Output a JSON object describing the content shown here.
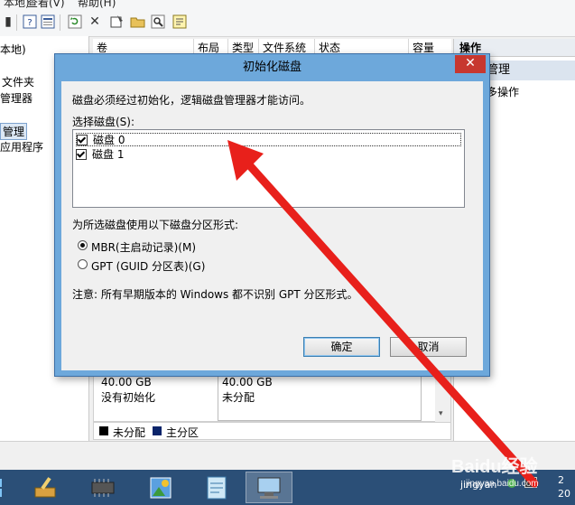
{
  "menubar": {
    "items": [
      "本地)",
      "查看(V)",
      "帮助(H)"
    ]
  },
  "toolbar": {
    "icons": [
      "back-icon",
      "up-icon",
      "help-icon",
      "properties-icon",
      "refresh-icon",
      "delete-icon",
      "settings-icon",
      "open-folder-icon",
      "search-icon",
      "export-icon"
    ]
  },
  "tree": {
    "items": [
      "本地)",
      "文件夹",
      "管理器",
      "管理",
      "应用程序"
    ]
  },
  "list_header": {
    "columns": [
      "卷",
      "布局",
      "类型",
      "文件系统",
      "状态",
      "容量"
    ]
  },
  "disk_area": {
    "disk0": {
      "size": "40.00 GB",
      "status": "没有初始化"
    },
    "disk1": {
      "size": "40.00 GB",
      "status": "未分配"
    }
  },
  "legend": {
    "unallocated": "未分配",
    "primary": "主分区"
  },
  "actions": {
    "header": "操作",
    "subheader": "管理",
    "more": "多操作"
  },
  "dialog": {
    "title": "初始化磁盘",
    "description": "磁盘必须经过初始化，逻辑磁盘管理器才能访问。",
    "select_label": "选择磁盘(S):",
    "disks": [
      {
        "label": "磁盘 0",
        "checked": true
      },
      {
        "label": "磁盘 1",
        "checked": true
      }
    ],
    "style_label": "为所选磁盘使用以下磁盘分区形式:",
    "options": [
      {
        "label": "MBR(主启动记录)(M)",
        "selected": true
      },
      {
        "label": "GPT (GUID 分区表)(G)",
        "selected": false
      }
    ],
    "note": "注意: 所有早期版本的 Windows 都不识别 GPT 分区形式。",
    "ok_label": "确定",
    "cancel_label": "取消"
  },
  "taskbar": {
    "apps": [
      "windows-icon",
      "paint-icon",
      "chip-icon",
      "photos-icon",
      "notepad-icon",
      "computer-management-icon"
    ],
    "tray_text": "jingyan",
    "clock": "2\n20"
  },
  "watermark": {
    "text": "Baidu经验",
    "sub": "jingyan.baidu.com"
  },
  "colors": {
    "dialog_frame": "#6da8db",
    "close_button": "#c7372f",
    "taskbar": "#2b4f77",
    "arrow": "#e8201b",
    "primary_partition": "#0a246a"
  }
}
